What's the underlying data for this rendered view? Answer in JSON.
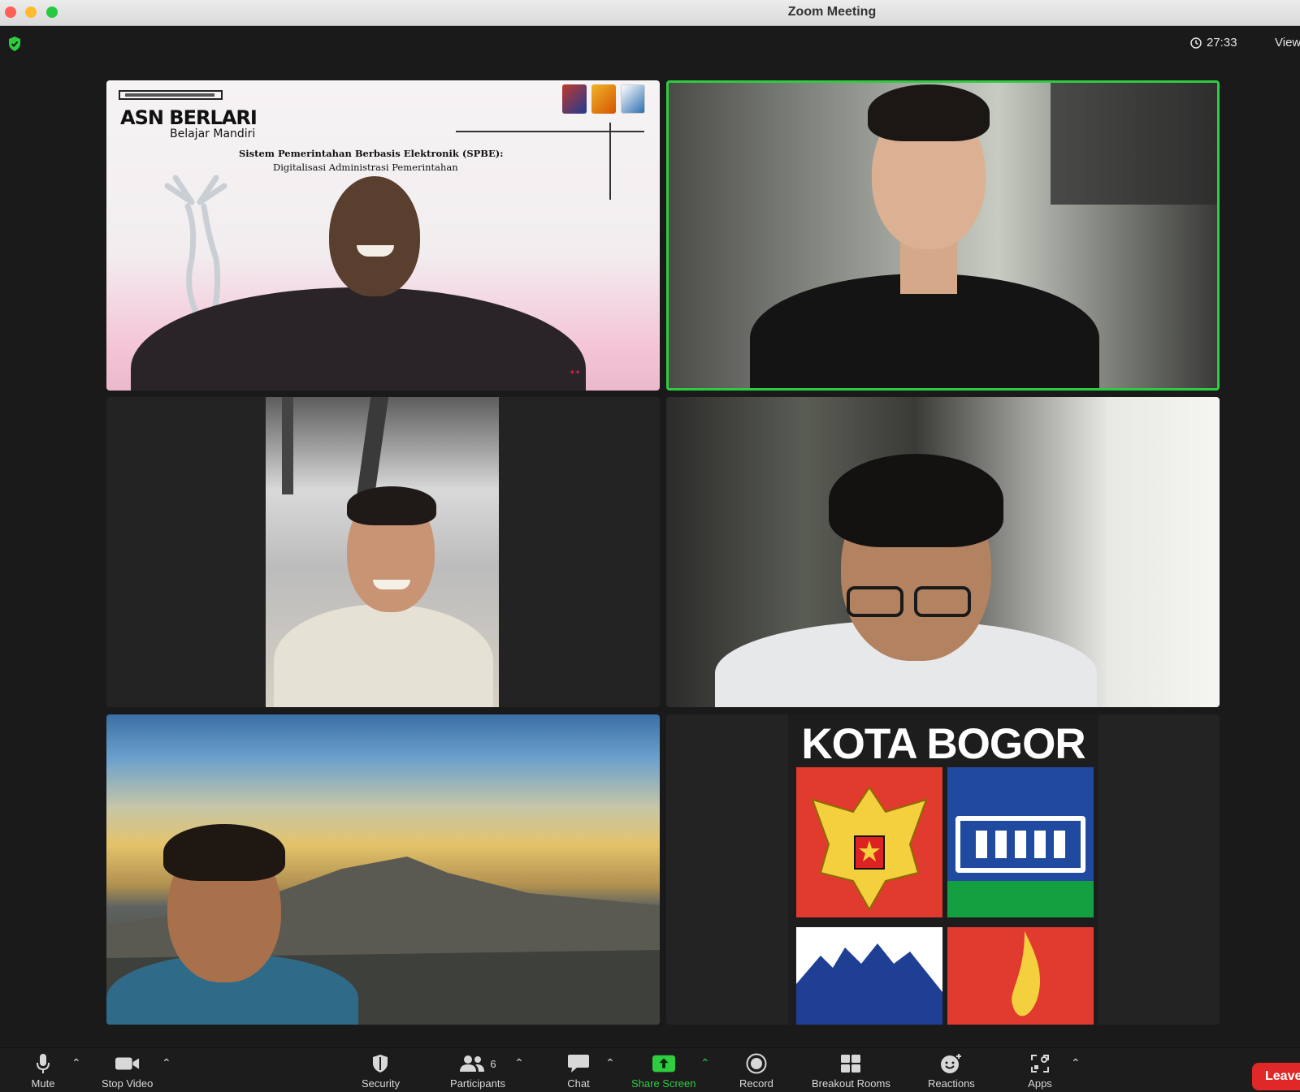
{
  "window": {
    "title": "Zoom Meeting"
  },
  "topbar": {
    "timer": "27:33",
    "view_label": "View"
  },
  "slide": {
    "title": "ASN BERLARI",
    "subtitle": "Belajar Mandiri",
    "heading1": "Sistem Pemerintahan Berbasis Elektronik (SPBE):",
    "heading2": "Digitalisasi Administrasi Pemerintahan"
  },
  "banner": {
    "title": "KOTA BOGOR"
  },
  "toolbar": {
    "mute": "Mute",
    "stop_video": "Stop Video",
    "security": "Security",
    "participants": "Participants",
    "participants_count": "6",
    "chat": "Chat",
    "share_screen": "Share Screen",
    "record": "Record",
    "breakout_rooms": "Breakout Rooms",
    "reactions": "Reactions",
    "apps": "Apps",
    "leave": "Leave"
  },
  "colors": {
    "active_speaker": "#2ecc40",
    "share_screen": "#2ecc40",
    "leave": "#e02828"
  }
}
